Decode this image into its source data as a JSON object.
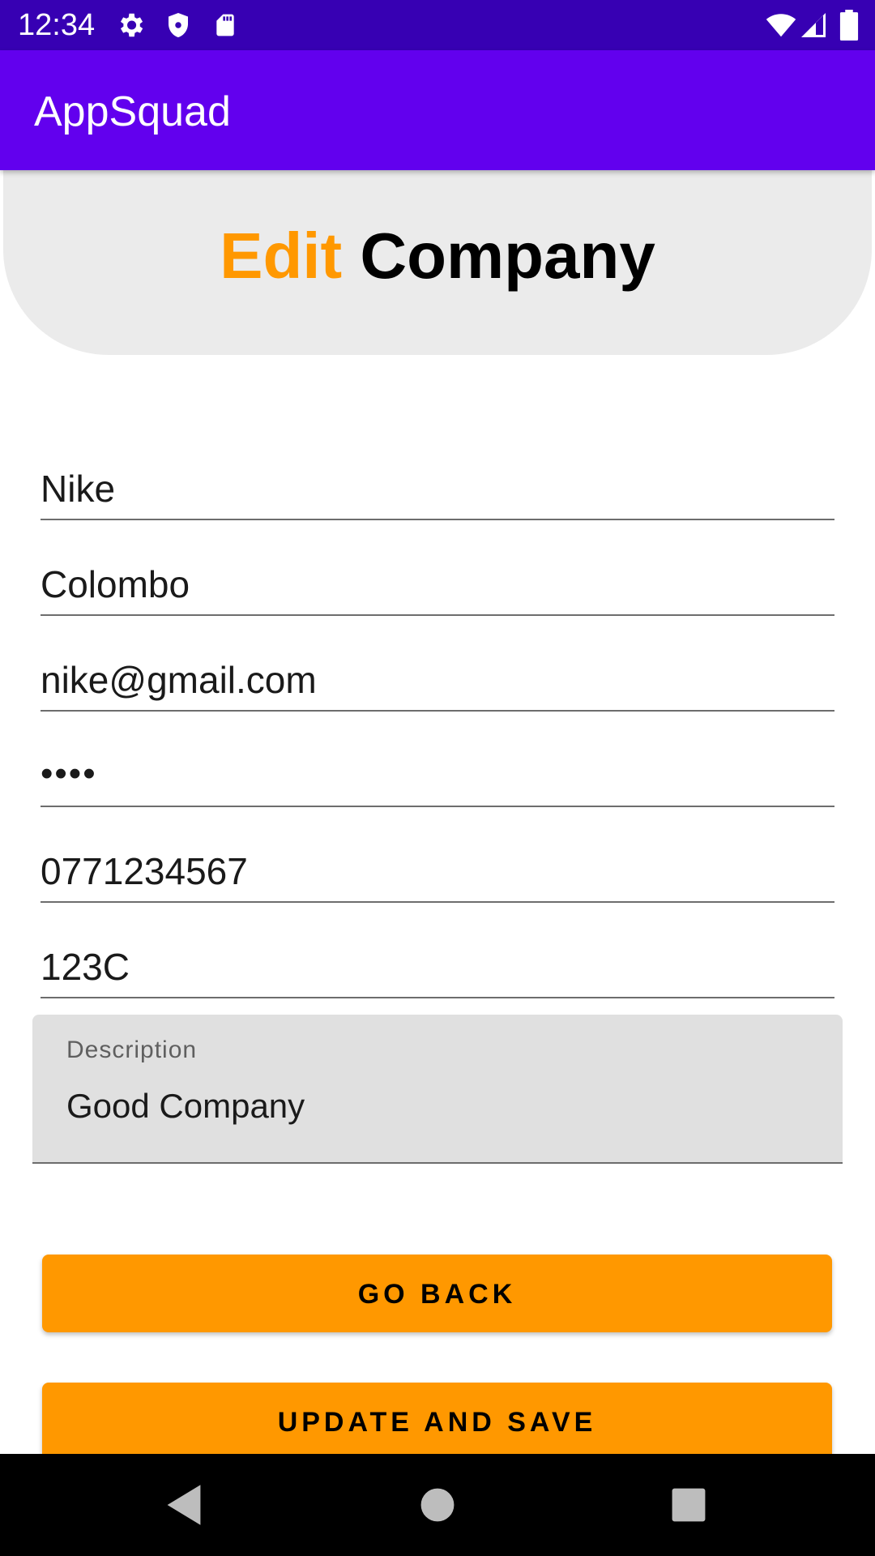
{
  "status_bar": {
    "time": "12:34",
    "left_icons": [
      "gear-icon",
      "shield-icon",
      "sd-card-icon"
    ],
    "right_icons": [
      "wifi-icon",
      "cell-signal-icon",
      "battery-icon"
    ]
  },
  "app_bar": {
    "title": "AppSquad"
  },
  "header": {
    "title_accent": "Edit",
    "title_main": "Company",
    "accent_color": "#ff9800"
  },
  "form": {
    "fields": [
      {
        "name": "company-name",
        "value": "Nike"
      },
      {
        "name": "city",
        "value": "Colombo"
      },
      {
        "name": "email",
        "value": "nike@gmail.com"
      },
      {
        "name": "password",
        "value": "••••"
      },
      {
        "name": "phone",
        "value": "0771234567"
      },
      {
        "name": "registration-number",
        "value": "123C"
      }
    ],
    "description": {
      "label": "Description",
      "value": "Good Company"
    }
  },
  "buttons": {
    "go_back": "GO BACK",
    "update_save": "UPDATE AND SAVE",
    "color": "#ff9800"
  },
  "nav_bar": {
    "buttons": [
      "back-icon",
      "home-icon",
      "recents-icon"
    ]
  },
  "colors": {
    "status_bar": "#3700b3",
    "app_bar": "#6200ee",
    "header_bg": "#ebebeb"
  }
}
